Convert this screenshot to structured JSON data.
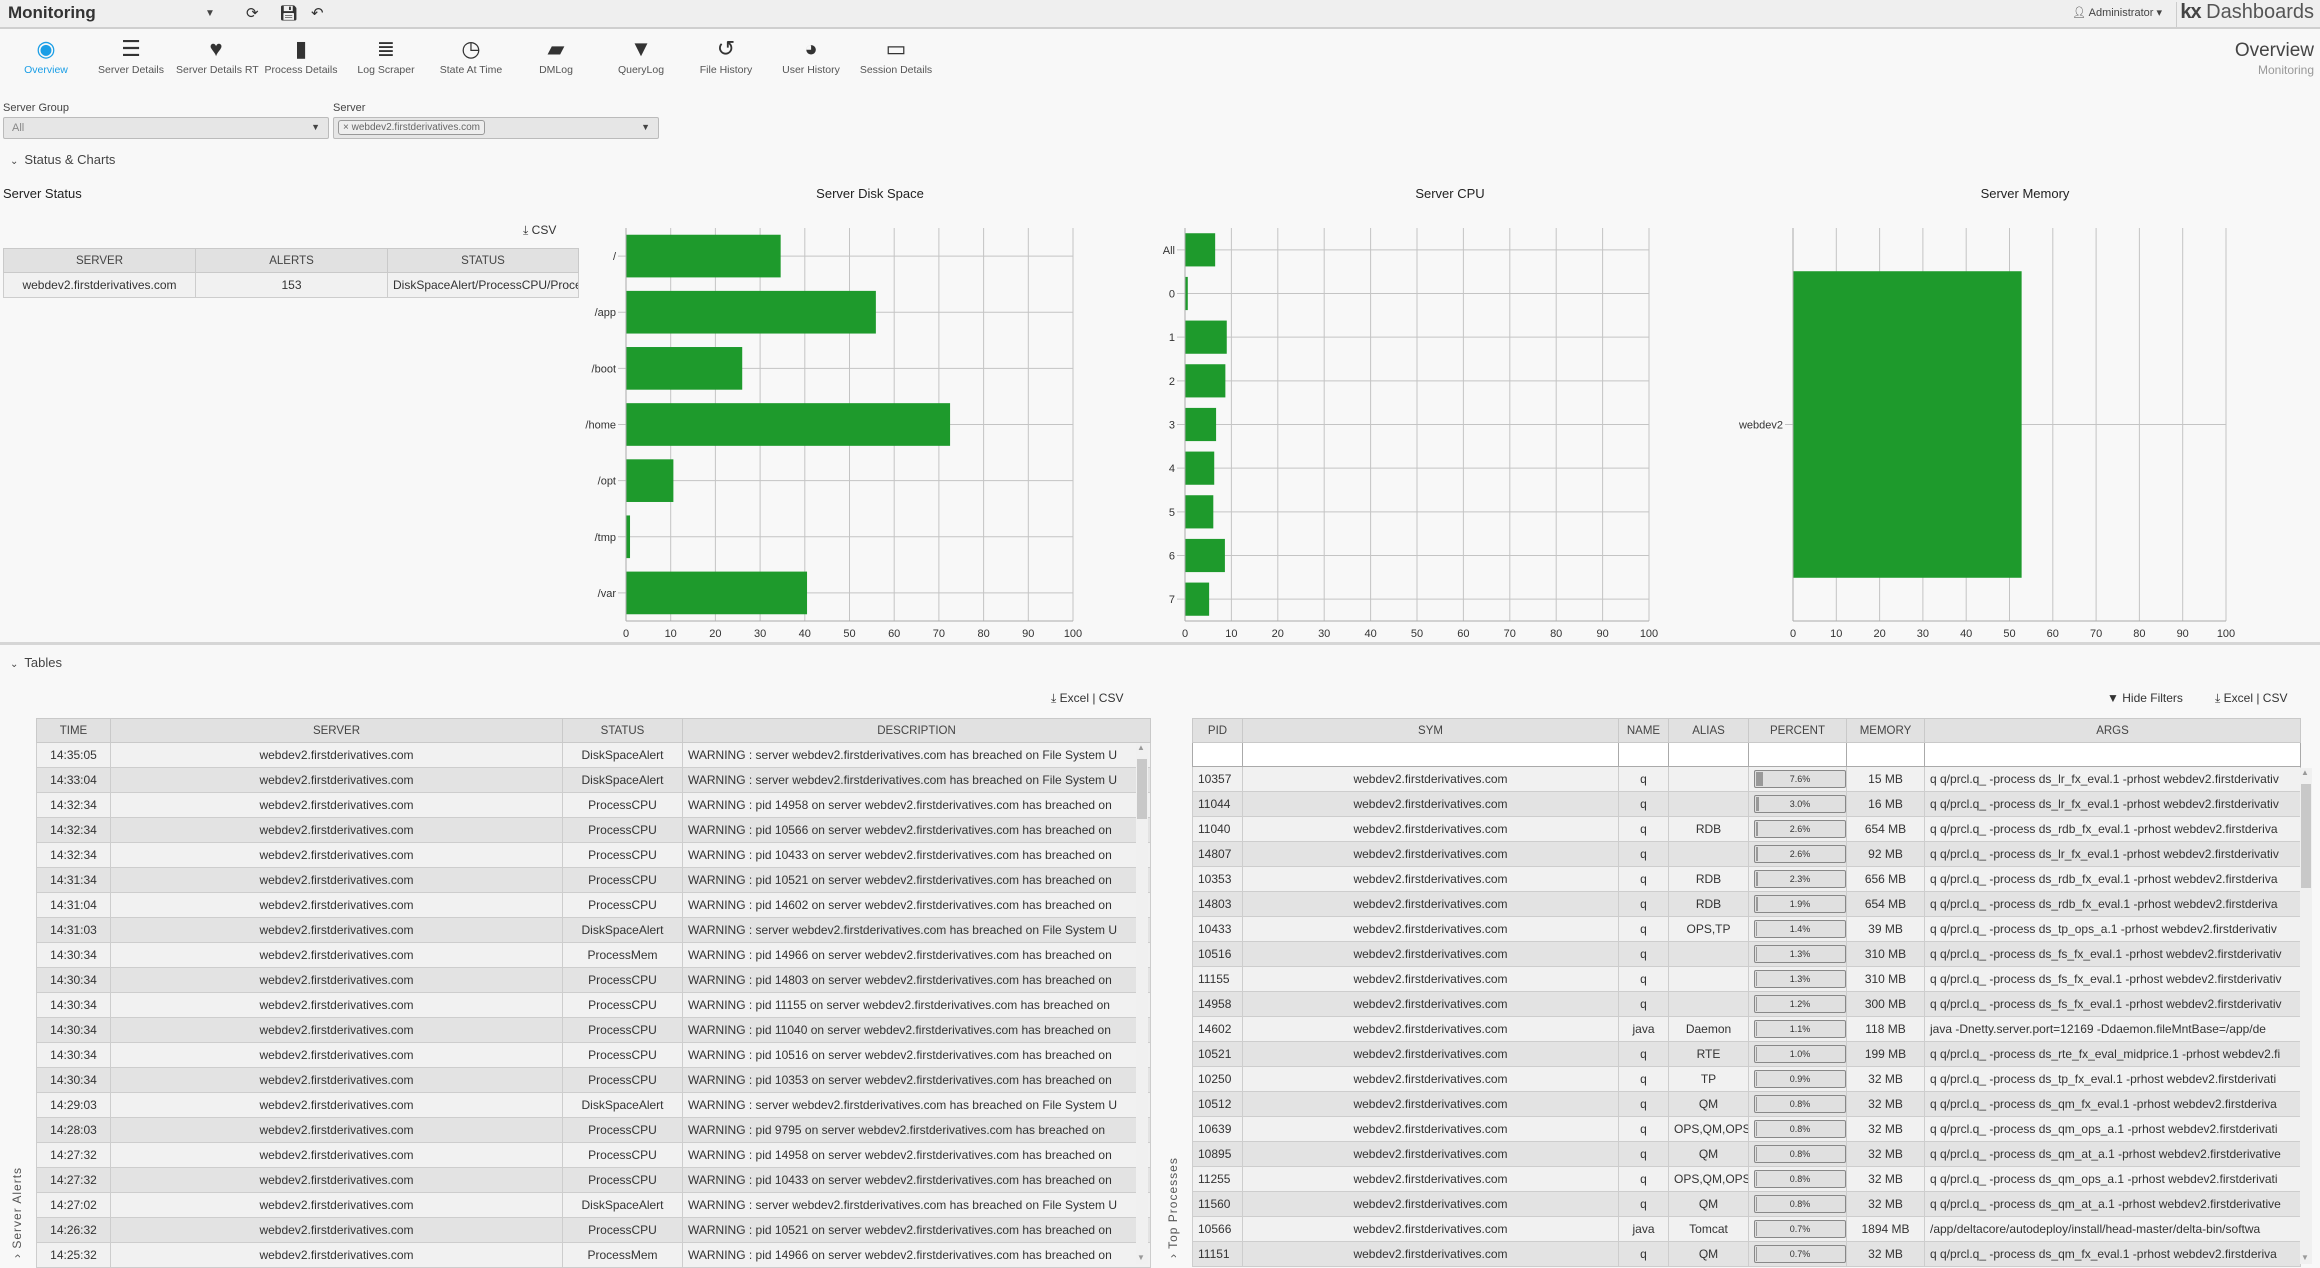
{
  "topbar": {
    "title": "Monitoring",
    "user": "Administrator",
    "brand_kx": "kx",
    "brand_name": "Dashboards"
  },
  "nav": [
    {
      "label": "Overview",
      "icon": "eye-icon",
      "glyph": "◉",
      "active": true
    },
    {
      "label": "Server Details",
      "icon": "server-icon",
      "glyph": "☰"
    },
    {
      "label": "Server Details RT",
      "icon": "heartbeat-icon",
      "glyph": "♥"
    },
    {
      "label": "Process Details",
      "icon": "chip-icon",
      "glyph": "▮"
    },
    {
      "label": "Log Scraper",
      "icon": "list-icon",
      "glyph": "≣"
    },
    {
      "label": "State At Time",
      "icon": "clock-icon",
      "glyph": "◷"
    },
    {
      "label": "DMLog",
      "icon": "book-icon",
      "glyph": "▰"
    },
    {
      "label": "QueryLog",
      "icon": "filter-icon",
      "glyph": "▼"
    },
    {
      "label": "File History",
      "icon": "history-icon",
      "glyph": "↺"
    },
    {
      "label": "User History",
      "icon": "user-circle-icon",
      "glyph": "◕"
    },
    {
      "label": "Session Details",
      "icon": "monitor-icon",
      "glyph": "▭"
    }
  ],
  "page": {
    "title": "Overview",
    "subtitle": "Monitoring"
  },
  "filters": {
    "group_label": "Server Group",
    "group_value": "All",
    "server_label": "Server",
    "server_chip": "× webdev2.firstderivatives.com"
  },
  "sections": {
    "status_charts": "Status & Charts",
    "tables": "Tables"
  },
  "server_status": {
    "title": "Server Status",
    "csv": "CSV",
    "columns": [
      "SERVER",
      "ALERTS",
      "STATUS"
    ],
    "rows": [
      [
        "webdev2.firstderivatives.com",
        "153",
        "DiskSpaceAlert/ProcessCPU/ProcessMem"
      ]
    ]
  },
  "chart_data": [
    {
      "type": "bar",
      "orientation": "horizontal",
      "title": "Server Disk Space",
      "categories": [
        "/",
        "/app",
        "/boot",
        "/home",
        "/opt",
        "/tmp",
        "/var"
      ],
      "values": [
        34.6,
        55.9,
        26.0,
        72.5,
        10.6,
        0.9,
        40.5
      ],
      "xlim": [
        0,
        100
      ],
      "xticks": [
        0,
        10,
        20,
        30,
        40,
        50,
        60,
        70,
        80,
        90,
        100
      ],
      "grid": true,
      "color": "#1e9a2c"
    },
    {
      "type": "bar",
      "orientation": "horizontal",
      "title": "Server CPU",
      "categories": [
        "All",
        "0",
        "1",
        "2",
        "3",
        "4",
        "5",
        "6",
        "7"
      ],
      "values": [
        6.5,
        0.6,
        9.0,
        8.7,
        6.7,
        6.3,
        6.1,
        8.6,
        5.2
      ],
      "xlim": [
        0,
        100
      ],
      "xticks": [
        0,
        10,
        20,
        30,
        40,
        50,
        60,
        70,
        80,
        90,
        100
      ],
      "grid": true,
      "color": "#1e9a2c"
    },
    {
      "type": "bar",
      "orientation": "horizontal",
      "title": "Server Memory",
      "categories": [
        "webdev2"
      ],
      "values": [
        52.8
      ],
      "xlim": [
        0,
        100
      ],
      "xticks": [
        0,
        10,
        20,
        30,
        40,
        50,
        60,
        70,
        80,
        90,
        100
      ],
      "grid": true,
      "color": "#1e9a2c"
    }
  ],
  "alerts": {
    "panel_label": "Server Alerts",
    "excel": "Excel",
    "csv": "CSV",
    "columns": [
      "TIME",
      "SERVER",
      "STATUS",
      "DESCRIPTION"
    ],
    "rows": [
      [
        "14:35:05",
        "webdev2.firstderivatives.com",
        "DiskSpaceAlert",
        "WARNING : server webdev2.firstderivatives.com has breached on File System U"
      ],
      [
        "14:33:04",
        "webdev2.firstderivatives.com",
        "DiskSpaceAlert",
        "WARNING : server webdev2.firstderivatives.com has breached on File System U"
      ],
      [
        "14:32:34",
        "webdev2.firstderivatives.com",
        "ProcessCPU",
        "WARNING : pid 14958 on server webdev2.firstderivatives.com has breached on"
      ],
      [
        "14:32:34",
        "webdev2.firstderivatives.com",
        "ProcessCPU",
        "WARNING : pid 10566 on server webdev2.firstderivatives.com has breached on"
      ],
      [
        "14:32:34",
        "webdev2.firstderivatives.com",
        "ProcessCPU",
        "WARNING : pid 10433 on server webdev2.firstderivatives.com has breached on"
      ],
      [
        "14:31:34",
        "webdev2.firstderivatives.com",
        "ProcessCPU",
        "WARNING : pid 10521 on server webdev2.firstderivatives.com has breached on"
      ],
      [
        "14:31:04",
        "webdev2.firstderivatives.com",
        "ProcessCPU",
        "WARNING : pid 14602 on server webdev2.firstderivatives.com has breached on"
      ],
      [
        "14:31:03",
        "webdev2.firstderivatives.com",
        "DiskSpaceAlert",
        "WARNING : server webdev2.firstderivatives.com has breached on File System U"
      ],
      [
        "14:30:34",
        "webdev2.firstderivatives.com",
        "ProcessMem",
        "WARNING : pid 14966 on server webdev2.firstderivatives.com has breached on"
      ],
      [
        "14:30:34",
        "webdev2.firstderivatives.com",
        "ProcessCPU",
        "WARNING : pid 14803 on server webdev2.firstderivatives.com has breached on"
      ],
      [
        "14:30:34",
        "webdev2.firstderivatives.com",
        "ProcessCPU",
        "WARNING : pid 11155 on server webdev2.firstderivatives.com has breached on"
      ],
      [
        "14:30:34",
        "webdev2.firstderivatives.com",
        "ProcessCPU",
        "WARNING : pid 11040 on server webdev2.firstderivatives.com has breached on"
      ],
      [
        "14:30:34",
        "webdev2.firstderivatives.com",
        "ProcessCPU",
        "WARNING : pid 10516 on server webdev2.firstderivatives.com has breached on"
      ],
      [
        "14:30:34",
        "webdev2.firstderivatives.com",
        "ProcessCPU",
        "WARNING : pid 10353 on server webdev2.firstderivatives.com has breached on"
      ],
      [
        "14:29:03",
        "webdev2.firstderivatives.com",
        "DiskSpaceAlert",
        "WARNING : server webdev2.firstderivatives.com has breached on File System U"
      ],
      [
        "14:28:03",
        "webdev2.firstderivatives.com",
        "ProcessCPU",
        "WARNING : pid 9795 on server webdev2.firstderivatives.com has breached on"
      ],
      [
        "14:27:32",
        "webdev2.firstderivatives.com",
        "ProcessCPU",
        "WARNING : pid 14958 on server webdev2.firstderivatives.com has breached on"
      ],
      [
        "14:27:32",
        "webdev2.firstderivatives.com",
        "ProcessCPU",
        "WARNING : pid 10433 on server webdev2.firstderivatives.com has breached on"
      ],
      [
        "14:27:02",
        "webdev2.firstderivatives.com",
        "DiskSpaceAlert",
        "WARNING : server webdev2.firstderivatives.com has breached on File System U"
      ],
      [
        "14:26:32",
        "webdev2.firstderivatives.com",
        "ProcessCPU",
        "WARNING : pid 10521 on server webdev2.firstderivatives.com has breached on"
      ],
      [
        "14:25:32",
        "webdev2.firstderivatives.com",
        "ProcessMem",
        "WARNING : pid 14966 on server webdev2.firstderivatives.com has breached on"
      ]
    ]
  },
  "processes": {
    "panel_label": "Top Processes",
    "hide_filters": "Hide Filters",
    "excel": "Excel",
    "csv": "CSV",
    "columns": [
      "PID",
      "SYM",
      "NAME",
      "ALIAS",
      "PERCENT",
      "MEMORY",
      "ARGS"
    ],
    "rows": [
      [
        "10357",
        "webdev2.firstderivatives.com",
        "q",
        "",
        "7.6%",
        "15 MB",
        "q q/prcl.q_ -process ds_lr_fx_eval.1 -prhost webdev2.firstderivativ"
      ],
      [
        "11044",
        "webdev2.firstderivatives.com",
        "q",
        "",
        "3.0%",
        "16 MB",
        "q q/prcl.q_ -process ds_lr_fx_eval.1 -prhost webdev2.firstderivativ"
      ],
      [
        "11040",
        "webdev2.firstderivatives.com",
        "q",
        "RDB",
        "2.6%",
        "654 MB",
        "q q/prcl.q_ -process ds_rdb_fx_eval.1 -prhost webdev2.firstderiva"
      ],
      [
        "14807",
        "webdev2.firstderivatives.com",
        "q",
        "",
        "2.6%",
        "92 MB",
        "q q/prcl.q_ -process ds_lr_fx_eval.1 -prhost webdev2.firstderivativ"
      ],
      [
        "10353",
        "webdev2.firstderivatives.com",
        "q",
        "RDB",
        "2.3%",
        "656 MB",
        "q q/prcl.q_ -process ds_rdb_fx_eval.1 -prhost webdev2.firstderiva"
      ],
      [
        "14803",
        "webdev2.firstderivatives.com",
        "q",
        "RDB",
        "1.9%",
        "654 MB",
        "q q/prcl.q_ -process ds_rdb_fx_eval.1 -prhost webdev2.firstderiva"
      ],
      [
        "10433",
        "webdev2.firstderivatives.com",
        "q",
        "OPS,TP",
        "1.4%",
        "39 MB",
        "q q/prcl.q_ -process ds_tp_ops_a.1 -prhost webdev2.firstderivativ"
      ],
      [
        "10516",
        "webdev2.firstderivatives.com",
        "q",
        "",
        "1.3%",
        "310 MB",
        "q q/prcl.q_ -process ds_fs_fx_eval.1 -prhost webdev2.firstderivativ"
      ],
      [
        "11155",
        "webdev2.firstderivatives.com",
        "q",
        "",
        "1.3%",
        "310 MB",
        "q q/prcl.q_ -process ds_fs_fx_eval.1 -prhost webdev2.firstderivativ"
      ],
      [
        "14958",
        "webdev2.firstderivatives.com",
        "q",
        "",
        "1.2%",
        "300 MB",
        "q q/prcl.q_ -process ds_fs_fx_eval.1 -prhost webdev2.firstderivativ"
      ],
      [
        "14602",
        "webdev2.firstderivatives.com",
        "java",
        "Daemon",
        "1.1%",
        "118 MB",
        "java -Dnetty.server.port=12169 -Ddaemon.fileMntBase=/app/de"
      ],
      [
        "10521",
        "webdev2.firstderivatives.com",
        "q",
        "RTE",
        "1.0%",
        "199 MB",
        "q q/prcl.q_ -process ds_rte_fx_eval_midprice.1 -prhost webdev2.fi"
      ],
      [
        "10250",
        "webdev2.firstderivatives.com",
        "q",
        "TP",
        "0.9%",
        "32 MB",
        "q q/prcl.q_ -process ds_tp_fx_eval.1 -prhost webdev2.firstderivati"
      ],
      [
        "10512",
        "webdev2.firstderivatives.com",
        "q",
        "QM",
        "0.8%",
        "32 MB",
        "q q/prcl.q_ -process ds_qm_fx_eval.1 -prhost webdev2.firstderiva"
      ],
      [
        "10639",
        "webdev2.firstderivatives.com",
        "q",
        "OPS,QM,OPS",
        "0.8%",
        "32 MB",
        "q q/prcl.q_ -process ds_qm_ops_a.1 -prhost webdev2.firstderivati"
      ],
      [
        "10895",
        "webdev2.firstderivatives.com",
        "q",
        "QM",
        "0.8%",
        "32 MB",
        "q q/prcl.q_ -process ds_qm_at_a.1 -prhost webdev2.firstderivative"
      ],
      [
        "11255",
        "webdev2.firstderivatives.com",
        "q",
        "OPS,QM,OPS",
        "0.8%",
        "32 MB",
        "q q/prcl.q_ -process ds_qm_ops_a.1 -prhost webdev2.firstderivati"
      ],
      [
        "11560",
        "webdev2.firstderivatives.com",
        "q",
        "QM",
        "0.8%",
        "32 MB",
        "q q/prcl.q_ -process ds_qm_at_a.1 -prhost webdev2.firstderivative"
      ],
      [
        "10566",
        "webdev2.firstderivatives.com",
        "java",
        "Tomcat",
        "0.7%",
        "1894 MB",
        "/app/deltacore/autodeploy/install/head-master/delta-bin/softwa"
      ],
      [
        "11151",
        "webdev2.firstderivatives.com",
        "q",
        "QM",
        "0.7%",
        "32 MB",
        "q q/prcl.q_ -process ds_qm_fx_eval.1 -prhost webdev2.firstderiva"
      ]
    ]
  }
}
